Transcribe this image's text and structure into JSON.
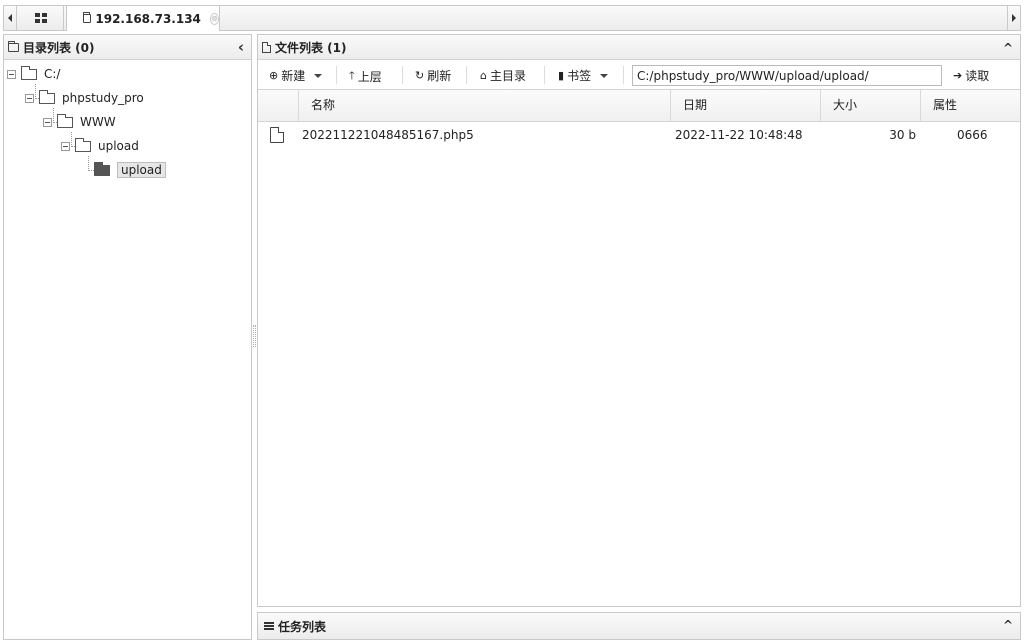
{
  "tabs": {
    "host_label": "192.168.73.134",
    "close_glyph": "⊗"
  },
  "tree_panel": {
    "title": "目录列表 (0)",
    "collapse_glyph": "‹",
    "nodes": [
      {
        "label": "C:/"
      },
      {
        "label": "phpstudy_pro"
      },
      {
        "label": "WWW"
      },
      {
        "label": "upload"
      },
      {
        "label": "upload"
      }
    ]
  },
  "file_panel": {
    "title": "文件列表 (1)",
    "collapse_glyph": "^",
    "toolbar": {
      "new_label": "新建",
      "up_label": "上层",
      "refresh_label": "刷新",
      "home_label": "主目录",
      "bookmark_label": "书签",
      "path_value": "C:/phpstudy_pro/WWW/upload/upload/",
      "read_label": "读取"
    },
    "columns": [
      "名称",
      "日期",
      "大小",
      "属性"
    ],
    "rows": [
      {
        "name": "202211221048485167.php5",
        "date": "2022-11-22 10:48:48",
        "size": "30 b",
        "attr": "0666"
      }
    ]
  },
  "task_panel": {
    "title": "任务列表",
    "collapse_glyph": "^"
  }
}
